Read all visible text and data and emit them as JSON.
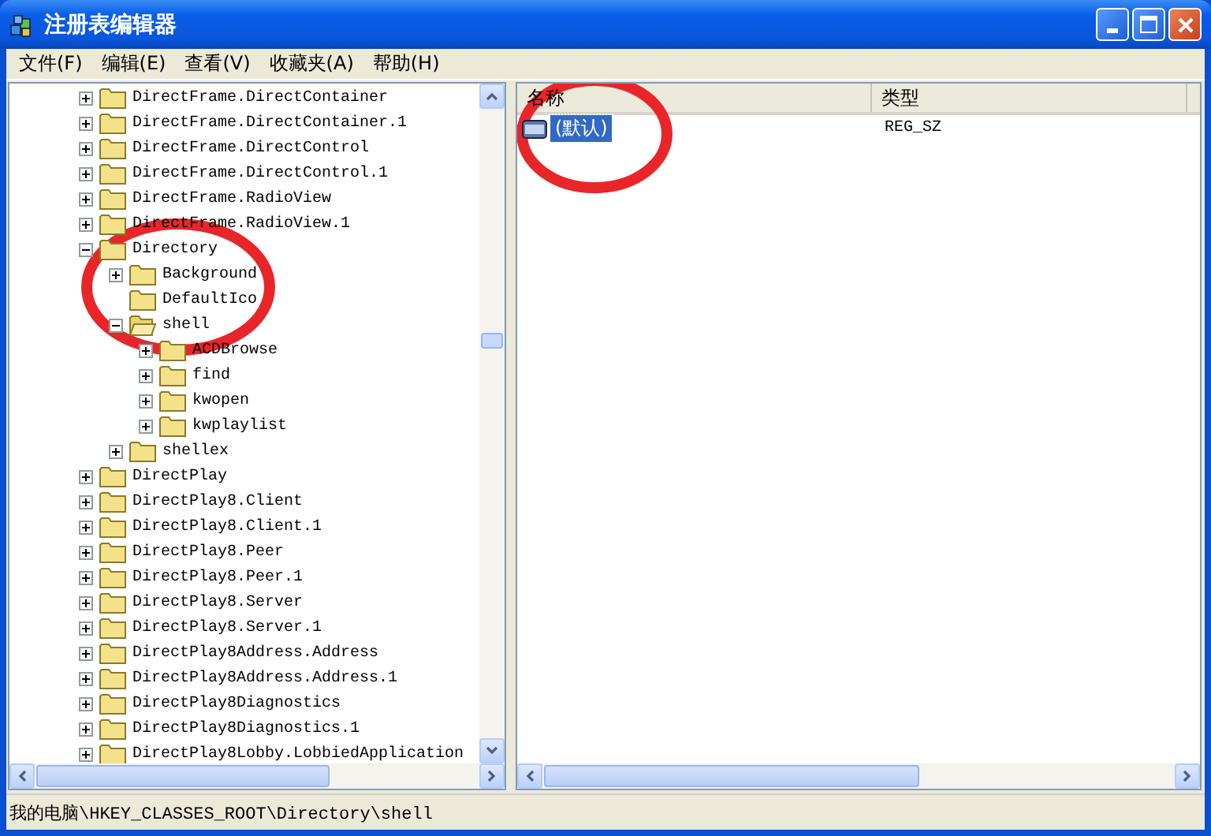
{
  "window": {
    "title": "注册表编辑器"
  },
  "menu": [
    "文件(F)",
    "编辑(E)",
    "查看(V)",
    "收藏夹(A)",
    "帮助(H)"
  ],
  "tree": [
    {
      "label": "DirectFrame.DirectContainer",
      "kind": "branch",
      "expanded": false,
      "selected": false
    },
    {
      "label": "DirectFrame.DirectContainer.1",
      "kind": "branch",
      "expanded": false,
      "selected": false
    },
    {
      "label": "DirectFrame.DirectControl",
      "kind": "branch",
      "expanded": false,
      "selected": false
    },
    {
      "label": "DirectFrame.DirectControl.1",
      "kind": "branch",
      "expanded": false,
      "selected": false
    },
    {
      "label": "DirectFrame.RadioView",
      "kind": "branch",
      "expanded": false,
      "selected": false
    },
    {
      "label": "DirectFrame.RadioView.1",
      "kind": "branch",
      "expanded": false,
      "selected": false
    },
    {
      "label": "Directory",
      "kind": "branch",
      "expanded": true,
      "selected": false,
      "children": [
        {
          "label": "Background",
          "kind": "branch",
          "expanded": false,
          "selected": false
        },
        {
          "label": "DefaultIco",
          "kind": "leaf",
          "selected": false
        },
        {
          "label": "shell",
          "kind": "branch",
          "expanded": true,
          "selected": true,
          "children": [
            {
              "label": "ACDBrowse",
              "kind": "branch",
              "expanded": false,
              "selected": false
            },
            {
              "label": "find",
              "kind": "branch",
              "expanded": false,
              "selected": false
            },
            {
              "label": "kwopen",
              "kind": "branch",
              "expanded": false,
              "selected": false
            },
            {
              "label": "kwplaylist",
              "kind": "branch",
              "expanded": false,
              "selected": false
            }
          ]
        },
        {
          "label": "shellex",
          "kind": "branch",
          "expanded": false,
          "selected": false
        }
      ]
    },
    {
      "label": "DirectPlay",
      "kind": "branch",
      "expanded": false,
      "selected": false
    },
    {
      "label": "DirectPlay8.Client",
      "kind": "branch",
      "expanded": false,
      "selected": false
    },
    {
      "label": "DirectPlay8.Client.1",
      "kind": "branch",
      "expanded": false,
      "selected": false
    },
    {
      "label": "DirectPlay8.Peer",
      "kind": "branch",
      "expanded": false,
      "selected": false
    },
    {
      "label": "DirectPlay8.Peer.1",
      "kind": "branch",
      "expanded": false,
      "selected": false
    },
    {
      "label": "DirectPlay8.Server",
      "kind": "branch",
      "expanded": false,
      "selected": false
    },
    {
      "label": "DirectPlay8.Server.1",
      "kind": "branch",
      "expanded": false,
      "selected": false
    },
    {
      "label": "DirectPlay8Address.Address",
      "kind": "branch",
      "expanded": false,
      "selected": false
    },
    {
      "label": "DirectPlay8Address.Address.1",
      "kind": "branch",
      "expanded": false,
      "selected": false
    },
    {
      "label": "DirectPlay8Diagnostics",
      "kind": "branch",
      "expanded": false,
      "selected": false
    },
    {
      "label": "DirectPlay8Diagnostics.1",
      "kind": "branch",
      "expanded": false,
      "selected": false
    },
    {
      "label": "DirectPlay8Lobby.LobbiedApplication",
      "kind": "branch",
      "expanded": false,
      "selected": false
    }
  ],
  "values": {
    "columns": [
      "名称",
      "类型"
    ],
    "rows": [
      {
        "name": "(默认)",
        "type": "REG_SZ",
        "selected": true
      }
    ]
  },
  "status_bar": "我的电脑\\HKEY_CLASSES_ROOT\\Directory\\shell"
}
